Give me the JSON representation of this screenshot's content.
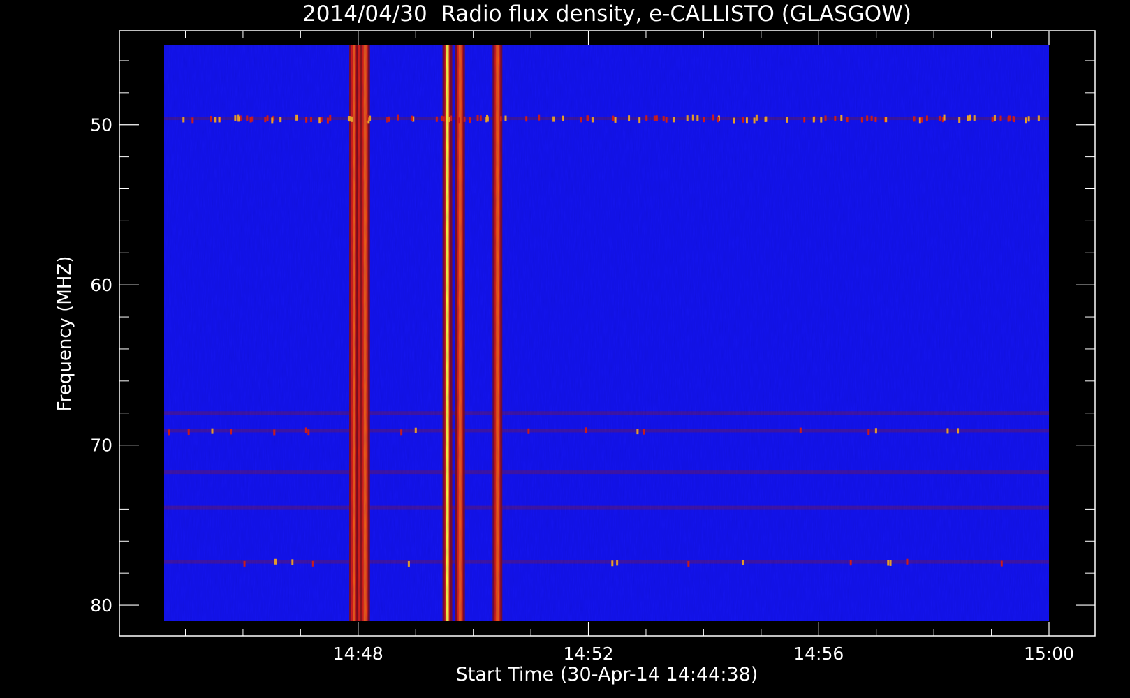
{
  "chart_data": {
    "type": "heatmap",
    "title": "2014/04/30  Radio flux density, e-CALLISTO (GLASGOW)",
    "xlabel": "Start Time (30-Apr-14 14:44:38)",
    "ylabel": "Frequency (MHZ)",
    "x_ticks": [
      "14:48",
      "14:52",
      "14:56",
      "15:00"
    ],
    "x_tick_minutes": [
      888,
      892,
      896,
      900
    ],
    "y_ticks": [
      "50",
      "60",
      "70",
      "80"
    ],
    "y_tick_values": [
      50,
      60,
      70,
      80
    ],
    "xlim_minutes": [
      884.63,
      900.0
    ],
    "ylim": [
      45.0,
      81.0
    ],
    "y_inverted": true,
    "colorscale": [
      "#0000ff",
      "#7a1020",
      "#d81a10",
      "#ff7a10",
      "#ffff40"
    ],
    "background_color": "#1515f0",
    "vertical_bursts": [
      {
        "t": 887.93,
        "intensity": 0.7
      },
      {
        "t": 888.05,
        "intensity": 0.75
      },
      {
        "t": 888.12,
        "intensity": 0.6
      },
      {
        "t": 889.55,
        "intensity": 1.0
      },
      {
        "t": 889.77,
        "intensity": 0.7
      },
      {
        "t": 890.42,
        "intensity": 0.6
      }
    ],
    "interference_lines_mhz": [
      49.6,
      68.0,
      69.1,
      71.7,
      73.9,
      77.3
    ]
  }
}
